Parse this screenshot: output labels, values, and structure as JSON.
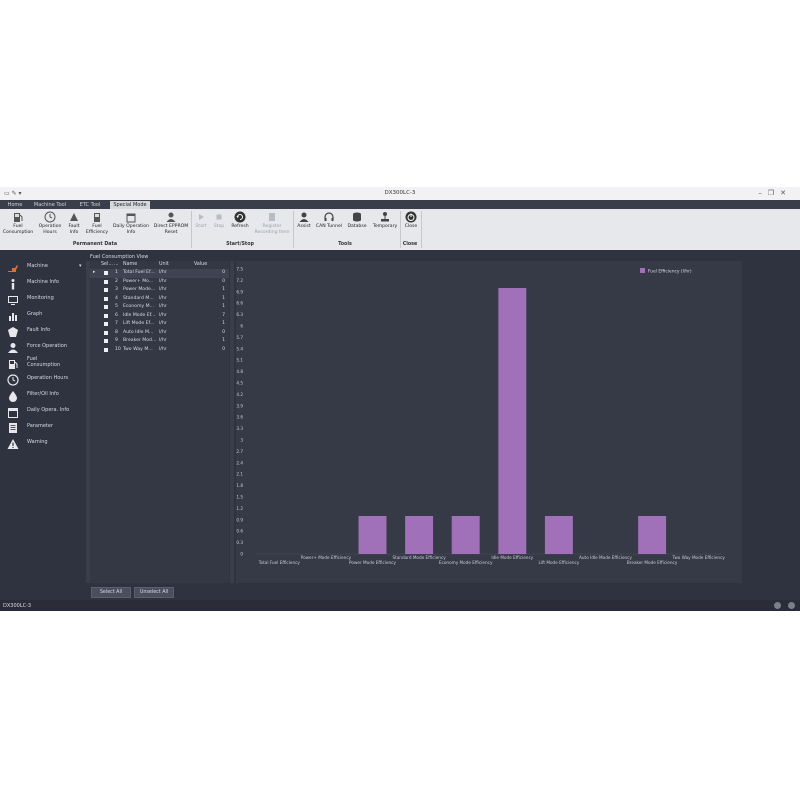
{
  "window": {
    "title": "DX300LC-3"
  },
  "tabs": [
    {
      "label": "Home"
    },
    {
      "label": "Machine Tool"
    },
    {
      "label": "ETC Tool"
    },
    {
      "label": "Special Mode"
    }
  ],
  "ribbon": {
    "buttons": [
      {
        "label": "Fuel Consumption",
        "icon": "fuel-pump-icon"
      },
      {
        "label": "Operation Hours",
        "icon": "clock-icon"
      },
      {
        "label": "Fault Info",
        "icon": "fault-icon"
      },
      {
        "label": "Fuel Efficiency",
        "icon": "fuel-efficiency-icon"
      },
      {
        "label": "Daily Operation Info",
        "icon": "calendar-icon"
      },
      {
        "label": "Direct EPPROM Reset",
        "icon": "user-reset-icon"
      },
      {
        "label": "Start",
        "icon": "start-icon"
      },
      {
        "label": "Stop",
        "icon": "stop-icon"
      },
      {
        "label": "Refresh",
        "icon": "refresh-icon"
      },
      {
        "label": "Register Recording Item",
        "icon": "register-icon"
      },
      {
        "label": "Assist",
        "icon": "assist-icon"
      },
      {
        "label": "CAN Tunnel",
        "icon": "headset-icon"
      },
      {
        "label": "Databse",
        "icon": "database-icon"
      },
      {
        "label": "Temporary",
        "icon": "joystick-icon"
      },
      {
        "label": "Close",
        "icon": "power-icon"
      }
    ],
    "groups": [
      {
        "label": "Permanent Data"
      },
      {
        "label": "Start/Stop"
      },
      {
        "label": "Tools"
      },
      {
        "label": "Close"
      }
    ]
  },
  "sidebar": {
    "items": [
      {
        "label": "Machine",
        "icon": "excavator-icon"
      },
      {
        "label": "Machine Info",
        "icon": "info-icon"
      },
      {
        "label": "Monitoring",
        "icon": "monitoring-icon"
      },
      {
        "label": "Graph",
        "icon": "graph-icon"
      },
      {
        "label": "Fault Info",
        "icon": "fault-icon"
      },
      {
        "label": "Force Operation",
        "icon": "force-operation-icon"
      },
      {
        "label": "Fuel Consumption",
        "icon": "fuel-pump-icon"
      },
      {
        "label": "Operation Hours",
        "icon": "clock-icon"
      },
      {
        "label": "Filter/Oil Info",
        "icon": "oil-drop-icon"
      },
      {
        "label": "Daily Opera. Info",
        "icon": "calendar-icon"
      },
      {
        "label": "Parameter",
        "icon": "parameter-icon"
      },
      {
        "label": "Warning",
        "icon": "warning-icon"
      }
    ]
  },
  "panel": {
    "title": "Fuel Consumption View"
  },
  "grid": {
    "headers": [
      "Sel...",
      "...",
      "Name",
      "Unit",
      "Value"
    ],
    "rows": [
      {
        "no": "1",
        "name": "Total Fuel Ef...",
        "unit": "l/hr",
        "value": "0"
      },
      {
        "no": "2",
        "name": "Power+ Mo...",
        "unit": "l/hr",
        "value": "0"
      },
      {
        "no": "3",
        "name": "Power Mode...",
        "unit": "l/hr",
        "value": "1"
      },
      {
        "no": "4",
        "name": "Standard M...",
        "unit": "l/hr",
        "value": "1"
      },
      {
        "no": "5",
        "name": "Economy M...",
        "unit": "l/hr",
        "value": "1"
      },
      {
        "no": "6",
        "name": "Idle Mode Ef...",
        "unit": "l/hr",
        "value": "7"
      },
      {
        "no": "7",
        "name": "Lift Mode Ef...",
        "unit": "l/hr",
        "value": "1"
      },
      {
        "no": "8",
        "name": "Auto Idle M...",
        "unit": "l/hr",
        "value": "0"
      },
      {
        "no": "9",
        "name": "Breaker Mod...",
        "unit": "l/hr",
        "value": "1"
      },
      {
        "no": "10",
        "name": "Two Way M...",
        "unit": "l/hr",
        "value": "0"
      }
    ]
  },
  "buttons": {
    "select_all": "Select All",
    "unselect_all": "Unselect All"
  },
  "status": {
    "text": "DX300LC-3"
  },
  "colors": {
    "bar": "#a070b8",
    "background": "#363a47"
  },
  "chart_data": {
    "type": "bar",
    "categories": [
      "Total Fuel Efficiency",
      "Power+ Mode Efficiency",
      "Power Mode Efficiency",
      "Standard Mode Efficiency",
      "Economy Mode Efficiency",
      "Idle Mode Efficiency",
      "Lift Mode Efficiency",
      "Auto Idle Mode Efficiency",
      "Breaker Mode Efficiency",
      "Two Way Mode Efficiency"
    ],
    "series": [
      {
        "name": "Fuel Efficiency (l/hr)",
        "values": [
          0,
          0,
          1,
          1,
          1,
          7,
          1,
          0,
          1,
          0
        ]
      }
    ],
    "yticks": [
      "0",
      "0.3",
      "0.6",
      "0.9",
      "1.2",
      "1.5",
      "1.8",
      "2.1",
      "2.4",
      "2.7",
      "3",
      "3.3",
      "3.6",
      "3.9",
      "4.2",
      "4.5",
      "4.8",
      "5.1",
      "5.4",
      "5.7",
      "6",
      "6.3",
      "6.6",
      "6.9",
      "7.2",
      "7.5"
    ],
    "ylim": [
      0,
      7.5
    ],
    "legend": "top-right",
    "grid": false
  }
}
